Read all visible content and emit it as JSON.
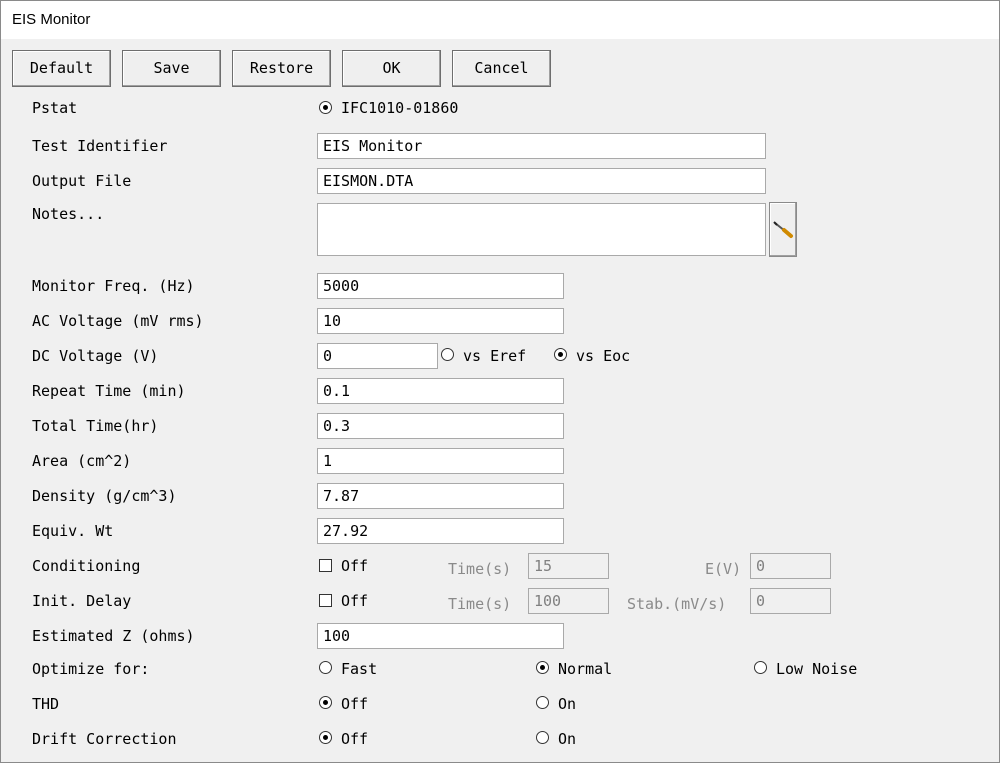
{
  "window": {
    "title": "EIS Monitor"
  },
  "toolbar": {
    "default": "Default",
    "save": "Save",
    "restore": "Restore",
    "ok": "OK",
    "cancel": "Cancel"
  },
  "pstat": {
    "label": "Pstat",
    "option": "IFC1010-01860",
    "selected": true
  },
  "test_identifier": {
    "label": "Test Identifier",
    "value": "EIS Monitor"
  },
  "output_file": {
    "label": "Output File",
    "value": "EISMON.DTA"
  },
  "notes": {
    "label": "Notes...",
    "value": ""
  },
  "monitor_freq": {
    "label": "Monitor Freq. (Hz)",
    "value": "5000"
  },
  "ac_voltage": {
    "label": "AC Voltage (mV rms)",
    "value": "10"
  },
  "dc_voltage": {
    "label": "DC Voltage (V)",
    "value": "0",
    "vs_eref": "vs Eref",
    "vs_eoc": "vs Eoc",
    "selected": "vs Eoc"
  },
  "repeat_time": {
    "label": "Repeat Time (min)",
    "value": "0.1"
  },
  "total_time": {
    "label": "Total Time(hr)",
    "value": "0.3"
  },
  "area": {
    "label": "Area (cm^2)",
    "value": "1"
  },
  "density": {
    "label": "Density (g/cm^3)",
    "value": "7.87"
  },
  "equiv_wt": {
    "label": "Equiv. Wt",
    "value": "27.92"
  },
  "conditioning": {
    "label": "Conditioning",
    "check_label": "Off",
    "checked": false,
    "time_label": "Time(s)",
    "time_value": "15",
    "e_label": "E(V)",
    "e_value": "0"
  },
  "init_delay": {
    "label": "Init. Delay",
    "check_label": "Off",
    "checked": false,
    "time_label": "Time(s)",
    "time_value": "100",
    "stab_label": "Stab.(mV/s)",
    "stab_value": "0"
  },
  "estimated_z": {
    "label": "Estimated Z (ohms)",
    "value": "100"
  },
  "optimize": {
    "label": "Optimize for:",
    "fast": "Fast",
    "normal": "Normal",
    "low_noise": "Low Noise",
    "selected": "Normal"
  },
  "thd": {
    "label": "THD",
    "off": "Off",
    "on": "On",
    "selected": "Off"
  },
  "drift": {
    "label": "Drift Correction",
    "off": "Off",
    "on": "On",
    "selected": "Off"
  }
}
